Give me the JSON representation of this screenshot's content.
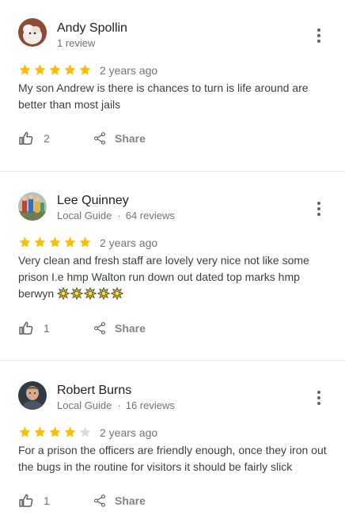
{
  "reviews": [
    {
      "author": "Andy Spollin",
      "meta": "1 review",
      "is_local_guide": false,
      "avatar_icon": "white-dog-photo",
      "rating": 5,
      "date": "2 years ago",
      "text": "My son Andrew is there is  chances to turn is life around are better than most jails",
      "likes": "2",
      "share_label": "Share"
    },
    {
      "author": "Lee Quinney",
      "meta": "Local Guide",
      "reviews_count": "64 reviews",
      "is_local_guide": true,
      "avatar_icon": "toy-figures-photo",
      "rating": 5,
      "date": "2 years ago",
      "text": "Very clean and fresh staff are lovely very nice not like some prison I.e hmp Walton run down out dated top marks hmp berwyn",
      "emoji_count": 5,
      "emoji_icon": "sparkle-emoji",
      "likes": "1",
      "share_label": "Share"
    },
    {
      "author": "Robert Burns",
      "meta": "Local Guide",
      "reviews_count": "16 reviews",
      "is_local_guide": true,
      "avatar_icon": "man-portrait-photo",
      "rating": 4,
      "date": "2 years ago",
      "text": "For a prison the officers are friendly enough, once they iron out the bugs in the routine for visitors it should be fairly slick",
      "likes": "1",
      "share_label": "Share"
    }
  ],
  "colors": {
    "star_filled": "#fbbc04",
    "star_empty": "#dadce0",
    "secondary_text": "#70757a",
    "divider": "#e6e6e6"
  }
}
